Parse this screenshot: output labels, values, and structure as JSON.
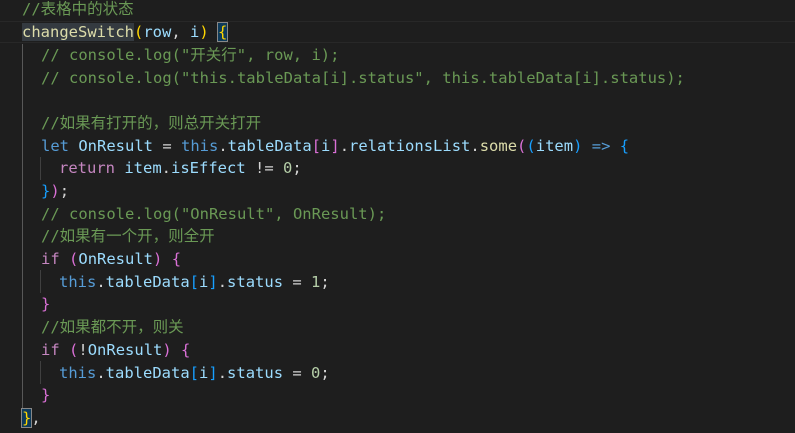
{
  "theme": {
    "background": "#1e1e1e",
    "comment": "#6a9955",
    "keyword_blue": "#569cd6",
    "keyword_purple": "#c586c0",
    "function": "#dcdcaa",
    "variable": "#9cdcfe",
    "number": "#b5cea8",
    "bracket_gold": "#ffd700",
    "bracket_violet": "#da70d6",
    "bracket_blue": "#179fff"
  },
  "code": {
    "l1": {
      "comment": "//表格中的状态"
    },
    "l2": {
      "fn": "changeSwitch",
      "open": "(",
      "param1": "row",
      "comma": ", ",
      "param2": "i",
      "close": ")",
      "space": " ",
      "brace": "{"
    },
    "l3": {
      "comment": "// console.log(\"开关行\", row, i);"
    },
    "l4": {
      "comment": "// console.log(\"this.tableData[i].status\", this.tableData[i].status);"
    },
    "l6": {
      "comment": "//如果有打开的，则总开关打开"
    },
    "l7": {
      "let": "let",
      "sp1": " ",
      "var": "OnResult",
      "eq": " = ",
      "this": "this",
      "dot1": ".",
      "prop1": "tableData",
      "lb": "[",
      "idx": "i",
      "rb": "]",
      "dot2": ".",
      "prop2": "relationsList",
      "dot3": ".",
      "fn": "some",
      "p1": "(",
      "p2": "(",
      "arg": "item",
      "p3": ")",
      "arrow": " => ",
      "brace": "{"
    },
    "l8": {
      "ret": "return",
      "sp": " ",
      "obj": "item",
      "dot": ".",
      "prop": "isEffect",
      "op": " != ",
      "num": "0",
      "semi": ";"
    },
    "l9": {
      "brace": "}",
      "paren": ")",
      "semi": ";"
    },
    "l10": {
      "comment": "// console.log(\"OnResult\", OnResult);"
    },
    "l11": {
      "comment": "//如果有一个开，则全开"
    },
    "l12": {
      "kw": "if",
      "sp": " ",
      "open": "(",
      "var": "OnResult",
      "close": ")",
      "sp2": " ",
      "brace": "{"
    },
    "l13": {
      "this": "this",
      "dot1": ".",
      "prop1": "tableData",
      "lb": "[",
      "idx": "i",
      "rb": "]",
      "dot2": ".",
      "prop2": "status",
      "op": " = ",
      "num": "1",
      "semi": ";"
    },
    "l14": {
      "brace": "}"
    },
    "l15": {
      "comment": "//如果都不开，则关"
    },
    "l16": {
      "kw": "if",
      "sp": " ",
      "open": "(",
      "not": "!",
      "var": "OnResult",
      "close": ")",
      "sp2": " ",
      "brace": "{"
    },
    "l17": {
      "this": "this",
      "dot1": ".",
      "prop1": "tableData",
      "lb": "[",
      "idx": "i",
      "rb": "]",
      "dot2": ".",
      "prop2": "status",
      "op": " = ",
      "num": "0",
      "semi": ";"
    },
    "l18": {
      "brace": "}"
    },
    "l19": {
      "brace": "}",
      "comma": ","
    }
  }
}
